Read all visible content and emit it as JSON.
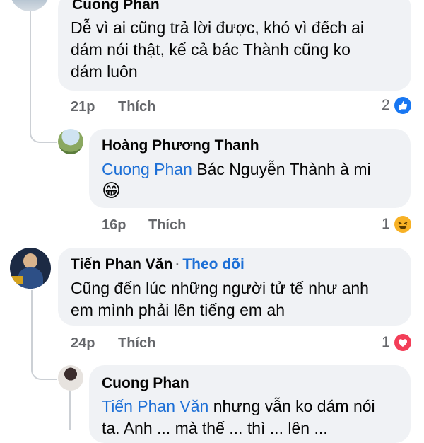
{
  "comments": [
    {
      "author": "Cuong Phan",
      "text_lines": [
        "Dễ vì ai cũng trả lời được, khó vì đếch ai",
        "dám nói thật, kể cả bác Thành cũng ko",
        "dám luôn"
      ],
      "time": "21p",
      "like_label": "Thích",
      "reaction_count": "2",
      "reaction_icon": "like-icon",
      "reaction_color": "#1877f2"
    },
    {
      "author": "Hoàng Phương Thanh",
      "mention": "Cuong Phan",
      "text": " Bác Nguyễn Thành à mi",
      "emoji": "😁",
      "time": "16p",
      "like_label": "Thích",
      "reaction_count": "1",
      "reaction_icon": "haha-icon",
      "reaction_color": "#f7b125"
    },
    {
      "author": "Tiến Phan Văn",
      "follow_label": "Theo dõi",
      "separator": "·",
      "text_lines": [
        "Cũng đến lúc những người tử tế như anh",
        "em mình phải lên tiếng em ah"
      ],
      "time": "24p",
      "like_label": "Thích",
      "reaction_count": "1",
      "reaction_icon": "love-icon",
      "reaction_color": "#f33e58"
    },
    {
      "author": "Cuong Phan",
      "mention": "Tiến Phan Văn",
      "text": " nhưng vẫn ko dám nói",
      "text_line2": "ta. Anh ... mà thế ... thì ... lên ..."
    }
  ]
}
